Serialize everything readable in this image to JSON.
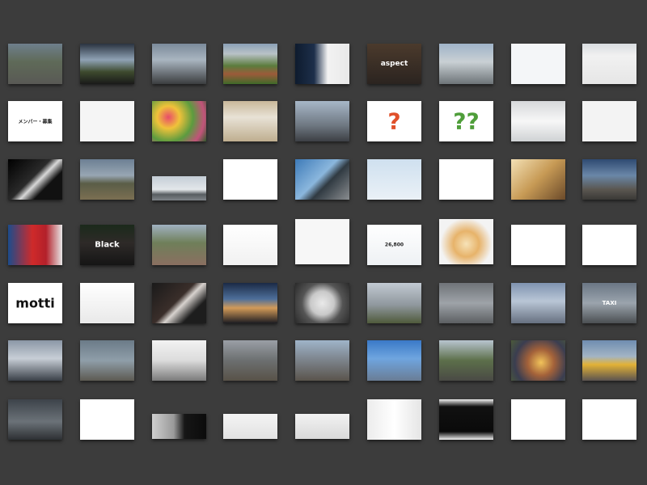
{
  "gallery": {
    "rows": [
      {
        "items": [
          {
            "name": "street-view",
            "bg": "linear-gradient(#6e7f8c 0%, #5f6a58 45%, #595955 100%)"
          },
          {
            "name": "car-window-view",
            "bg": "linear-gradient(#2a3340 0%, #8fa2b5 40%, #3d4a2e 70%, #1a1a1a 100%)"
          },
          {
            "name": "overcast-sky",
            "bg": "linear-gradient(#7b8a9a 0%, #a9b5c0 40%, #3b3d3f 100%)"
          },
          {
            "name": "sports-field",
            "bg": "linear-gradient(#8aa0b5 0%, #b9c2c7 25%, #5b7c3d 55%, #9c5b3a 75%, #3f6a2a 100%)"
          },
          {
            "name": "camera-lens-ad",
            "bg": "linear-gradient(90deg, #0e1b2e 0%, #1d2f4a 35%, #f2f2f2 60%, #e9e9e9 100%)"
          },
          {
            "name": "aspect-photographer",
            "bg": "linear-gradient(#4b3a2c 0%, #2b2420 100%)",
            "label": "aspect",
            "color": "#ffffff",
            "size": "9px"
          },
          {
            "name": "harbor-view",
            "bg": "linear-gradient(#9fb3c8 0%, #c9d0d4 45%, #6d7478 100%)"
          },
          {
            "name": "white-gadget",
            "bg": "#f4f6f8"
          },
          {
            "name": "web-page-screenshot",
            "bg": "linear-gradient(#d9dde0 0%, #f1f1f1 30%, #e6e6e6 100%)"
          }
        ]
      },
      {
        "items": [
          {
            "name": "member-mail",
            "bg": "#ffffff",
            "label": "メンバー・募集",
            "color": "#222222",
            "size": "6px"
          },
          {
            "name": "silver-hard-drive",
            "bg": "#f5f5f5"
          },
          {
            "name": "flower-bouquet",
            "bg": "radial-gradient(circle at 30% 40%, #e84b6a 0%, #f0c23a 25%, #5c9b3f 55%, #c2537a 80%, #2e5a2a 100%)"
          },
          {
            "name": "calendar-board",
            "bg": "linear-gradient(#c9b89a 0%, #e8e2d6 40%, #bfae8f 100%)"
          },
          {
            "name": "skyscraper-crowd",
            "bg": "linear-gradient(#a7b7c8 0%, #6f7882 60%, #3c3f44 100%)"
          },
          {
            "name": "question-mark-red",
            "bg": "#ffffff",
            "label": "?",
            "color": "#e0502a",
            "size": "28px"
          },
          {
            "name": "question-marks-green",
            "bg": "#ffffff",
            "label": "??",
            "color": "#4f9e3a",
            "size": "28px"
          },
          {
            "name": "white-phone-back",
            "bg": "linear-gradient(#d6d8da 0%, #f7f7f7 50%, #cfd2d4 100%)"
          },
          {
            "name": "glass-container",
            "bg": "#f3f3f3"
          }
        ]
      },
      {
        "items": [
          {
            "name": "dark-light-beam",
            "bg": "linear-gradient(135deg, #000000 0%, #2a2a2a 45%, #d8d8d8 55%, #111111 70%)"
          },
          {
            "name": "bridge-construction",
            "bg": "linear-gradient(#6c7f93 0%, #98a6b3 40%, #5a5d47 60%, #7b6f52 100%)"
          },
          {
            "name": "city-panorama",
            "bg": "linear-gradient(#c4cdd6 0%, #e3e7ea 55%, #585d61 75%, #7f8489 100%)"
          },
          {
            "name": "iphone-products",
            "bg": "#ffffff"
          },
          {
            "name": "elevated-highway",
            "bg": "linear-gradient(135deg, #3d7ab8 0%, #8bb7dd 45%, #303a42 60%, #8a8d90 100%)"
          },
          {
            "name": "helicopter",
            "bg": "linear-gradient(#cfe0ef 0%, #eaf1f7 100%)"
          },
          {
            "name": "blue-house-logo",
            "bg": "#ffffff"
          },
          {
            "name": "plant-on-table",
            "bg": "linear-gradient(135deg, #f3e0b5 0%, #c79a55 50%, #6b4a2a 100%)"
          },
          {
            "name": "concrete-building",
            "bg": "linear-gradient(#2f4b72 0%, #6a87a8 40%, #5a5650 75%, #3a3936 100%)"
          }
        ]
      },
      {
        "items": [
          {
            "name": "book-store-front",
            "bg": "linear-gradient(90deg, #1c4c8c 0%, #cf2a2a 45%, #b3202a 70%, #e8e8e8 100%)"
          },
          {
            "name": "black-poster",
            "bg": "linear-gradient(#1b2a1b 0%, #2e2a28 45%, #151515 100%)",
            "label": "Black",
            "color": "#ffffff",
            "size": "10px"
          },
          {
            "name": "garden-path",
            "bg": "linear-gradient(#a0b1c1 0%, #6f7f59 45%, #8a6f61 100%)"
          },
          {
            "name": "black-speakers",
            "bg": "linear-gradient(#ffffff 0%, #f1f1f1 100%)"
          },
          {
            "name": "product-web-page",
            "bg": "#f7f7f7"
          },
          {
            "name": "silver-car-ad",
            "bg": "linear-gradient(#ffffff 0%, #eef1f4 100%)",
            "label": "26,800",
            "color": "#222222",
            "size": "6px"
          },
          {
            "name": "pasta-dish",
            "bg": "radial-gradient(circle at 50% 55%, #f6e2b8 0%, #e7b36a 35%, #f3f3f3 70%)"
          },
          {
            "name": "imac-computer",
            "bg": "#ffffff"
          },
          {
            "name": "color-gamut-chart",
            "bg": "#ffffff"
          }
        ]
      },
      {
        "items": [
          {
            "name": "motti-cover",
            "bg": "#ffffff",
            "label": "motti",
            "color": "#111111",
            "size": "16px"
          },
          {
            "name": "calculator",
            "bg": "linear-gradient(#ffffff 0%, #e9e9e9 100%)"
          },
          {
            "name": "piano-keys-dark",
            "bg": "linear-gradient(135deg, #1a1a1a 0%, #3a2e2a 45%, #d8d3cf 55%, #1d1d1d 75%)"
          },
          {
            "name": "sunset-sea",
            "bg": "linear-gradient(#1b2a45 0%, #4e6f9a 40%, #d29a58 62%, #1c1c22 100%)"
          },
          {
            "name": "pressure-gauge",
            "bg": "radial-gradient(circle at 50% 50%, #e9e9e9 0%, #c9c9c9 35%, #555555 60%, #2a2a2a 100%)"
          },
          {
            "name": "city-buildings",
            "bg": "linear-gradient(#c2cad3 0%, #8f979d 55%, #4f5a3b 100%)"
          },
          {
            "name": "glass-tower-grey",
            "bg": "linear-gradient(#6f7378 0%, #9ea3a8 50%, #5c5f62 100%)"
          },
          {
            "name": "tall-building-sky",
            "bg": "linear-gradient(#7f93b0 0%, #b9c6d6 45%, #667080 100%)"
          },
          {
            "name": "taxi-sign",
            "bg": "linear-gradient(#6a7684 0%, #9ba4ad 50%, #4b4f52 100%)",
            "label": "TAXI",
            "color": "#ffffff",
            "size": "7px"
          }
        ]
      },
      {
        "items": [
          {
            "name": "twin-towers",
            "bg": "linear-gradient(#8b97a6 0%, #c7ced6 45%, #3a4048 100%)"
          },
          {
            "name": "glass-office",
            "bg": "linear-gradient(#6b7b88 0%, #8f9ea9 50%, #5d5a52 100%)"
          },
          {
            "name": "white-shop-front",
            "bg": "linear-gradient(#f2f2f2 0%, #dcdcdc 50%, #7a7a7a 100%)"
          },
          {
            "name": "shopping-street",
            "bg": "linear-gradient(#9a9fa6 0%, #6c6f70 50%, #585248 100%)"
          },
          {
            "name": "busy-crossing",
            "bg": "linear-gradient(#9fb4c9 0%, #7f8790 45%, #5a544c 100%)"
          },
          {
            "name": "blue-glass-building",
            "bg": "linear-gradient(#3a79c7 0%, #6fa5df 45%, #6a7d95 100%)"
          },
          {
            "name": "tree-lined-road",
            "bg": "linear-gradient(#b8c4cf 0%, #5c6f4a 50%, #4a4a45 100%)"
          },
          {
            "name": "lit-window-building",
            "bg": "radial-gradient(circle at 55% 55%, #f1c35a 0%, #a4623a 35%, #3a3d50 70%, #4b5a3a 100%)"
          },
          {
            "name": "yellow-tram",
            "bg": "linear-gradient(#6f8db0 0%, #a3b4c4 40%, #e2b236 60%, #5a5350 100%)"
          }
        ]
      },
      {
        "items": [
          {
            "name": "misty-road",
            "bg": "linear-gradient(#3d434a 0%, #6b7278 55%, #2d3033 100%)"
          },
          {
            "name": "white-bottle",
            "bg": "#ffffff"
          },
          {
            "name": "metal-panel-dark",
            "bg": "linear-gradient(90deg, #cfcfcf 0%, #9a9a9a 40%, #161616 60%, #0b0b0b 100%)"
          },
          {
            "name": "office-desk",
            "bg": "linear-gradient(#f4f4f4 0%, #e2e2e2 100%)"
          },
          {
            "name": "studio-furniture",
            "bg": "linear-gradient(#f2f2f2 0%, #d9d9d9 100%)"
          },
          {
            "name": "catalog-spread",
            "bg": "linear-gradient(90deg, #ececec 0%, #ffffff 50%, #e5e5e5 100%)"
          },
          {
            "name": "dark-laptop",
            "bg": "linear-gradient(#f2f2f2 0%, #111111 18%, #0a0a0a 80%, #f0f0f0 100%)"
          },
          {
            "name": "metal-keys",
            "bg": "#ffffff"
          },
          {
            "name": "drone-quadcopter",
            "bg": "#ffffff"
          }
        ]
      }
    ]
  }
}
